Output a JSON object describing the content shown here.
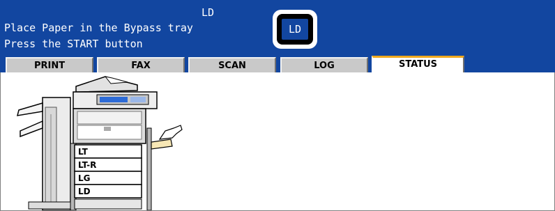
{
  "message": {
    "paper_size_top": "LD",
    "line1": "Place Paper in the Bypass tray",
    "line2": "Press the START button"
  },
  "indicator": {
    "label": "LD"
  },
  "tabs": [
    {
      "label": "PRINT",
      "active": false
    },
    {
      "label": "FAX",
      "active": false
    },
    {
      "label": "SCAN",
      "active": false
    },
    {
      "label": "LOG",
      "active": false
    },
    {
      "label": "STATUS",
      "active": true
    }
  ],
  "machine": {
    "drawers": [
      "LT",
      "LT-R",
      "LG",
      "LD"
    ]
  },
  "colors": {
    "header_blue": "#1246a0",
    "tab_gray": "#c9c9c9",
    "active_tab_accent": "#f0a81c"
  }
}
